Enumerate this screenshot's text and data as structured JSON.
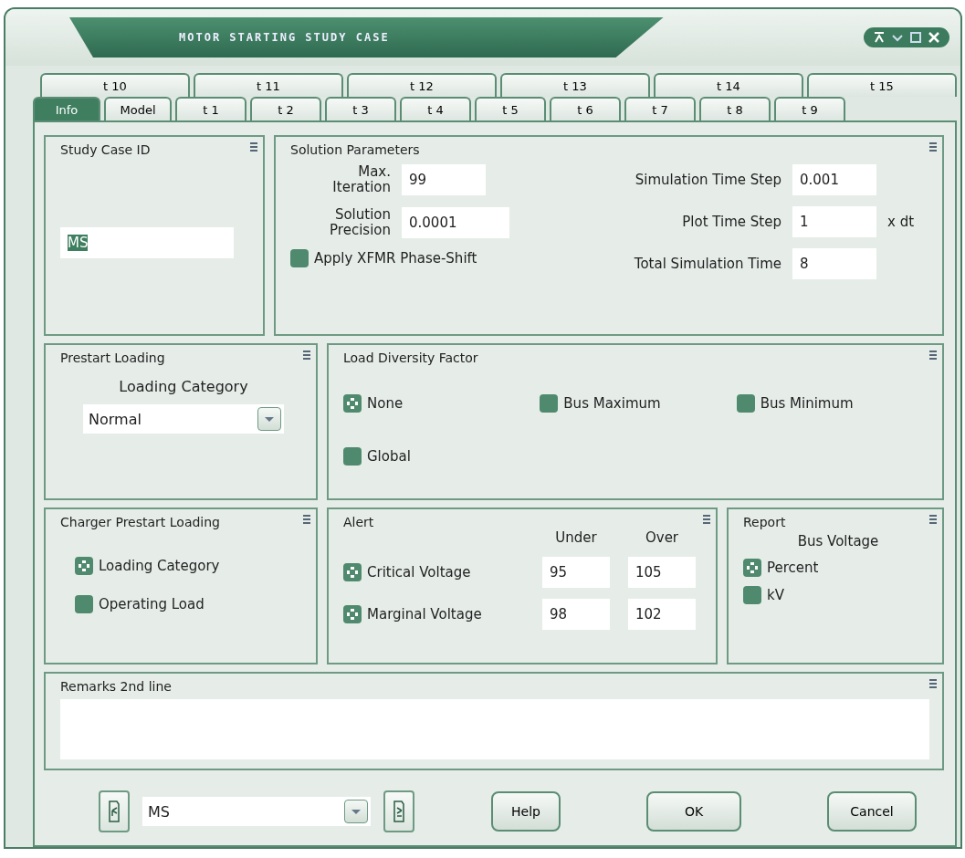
{
  "window": {
    "title": "MOTOR STARTING STUDY CASE"
  },
  "tab_rows": [
    {
      "tabs": [
        {
          "label": "t 10",
          "selected": false
        },
        {
          "label": "t 11",
          "selected": false
        },
        {
          "label": "t 12",
          "selected": false
        },
        {
          "label": "t 13",
          "selected": false
        },
        {
          "label": "t 14",
          "selected": false
        },
        {
          "label": "t 15",
          "selected": false
        }
      ]
    },
    {
      "tabs": [
        {
          "label": "Info",
          "selected": true
        },
        {
          "label": "Model",
          "selected": false
        },
        {
          "label": "t 1",
          "selected": false
        },
        {
          "label": "t 2",
          "selected": false
        },
        {
          "label": "t 3",
          "selected": false
        },
        {
          "label": "t 4",
          "selected": false
        },
        {
          "label": "t 5",
          "selected": false
        },
        {
          "label": "t 6",
          "selected": false
        },
        {
          "label": "t 7",
          "selected": false
        },
        {
          "label": "t 8",
          "selected": false
        },
        {
          "label": "t 9",
          "selected": false
        }
      ]
    }
  ],
  "study_case_id": {
    "title": "Study Case ID",
    "value": "MS"
  },
  "solution_parameters": {
    "title": "Solution Parameters",
    "left_fields": [
      {
        "label": "Max. Iteration",
        "value": "99"
      },
      {
        "label": "Solution Precision",
        "value": "0.0001"
      }
    ],
    "apply_xfmr": {
      "label": "Apply XFMR Phase-Shift",
      "checked": false
    },
    "right_fields": [
      {
        "label": "Simulation Time Step",
        "value": "0.001"
      },
      {
        "label": "Plot Time Step",
        "value": "1",
        "unit": "x dt"
      },
      {
        "label": "Total Simulation Time",
        "value": "8"
      }
    ]
  },
  "prestart_loading": {
    "title": "Prestart Loading",
    "label": "Loading Category",
    "value": "Normal"
  },
  "load_diversity_factor": {
    "title": "Load Diversity Factor",
    "options": [
      {
        "label": "None",
        "selected": true
      },
      {
        "label": "Bus Maximum",
        "selected": false
      },
      {
        "label": "Bus Minimum",
        "selected": false
      },
      {
        "label": "Global",
        "selected": false
      }
    ]
  },
  "charger_prestart_loading": {
    "title": "Charger Prestart Loading",
    "options": [
      {
        "label": "Loading Category",
        "selected": true
      },
      {
        "label": "Operating Load",
        "selected": false
      }
    ]
  },
  "alert": {
    "title": "Alert",
    "columns": [
      "Under",
      "Over"
    ],
    "rows": [
      {
        "label": "Critical Voltage",
        "checked": true,
        "under": "95",
        "over": "105"
      },
      {
        "label": "Marginal Voltage",
        "checked": true,
        "under": "98",
        "over": "102"
      }
    ]
  },
  "report": {
    "title": "Report",
    "label": "Bus Voltage",
    "options": [
      {
        "label": "Percent",
        "selected": true
      },
      {
        "label": "kV",
        "selected": false
      }
    ]
  },
  "remarks": {
    "title": "Remarks 2nd line"
  },
  "footer": {
    "case_value": "MS",
    "buttons": [
      "Help",
      "OK",
      "Cancel"
    ]
  }
}
